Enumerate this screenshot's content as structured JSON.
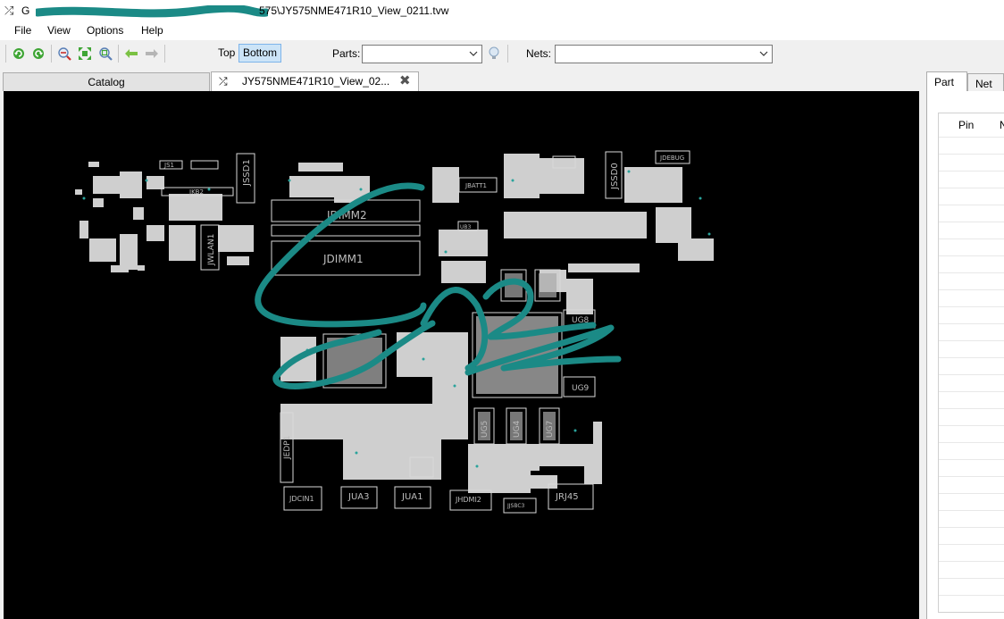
{
  "window": {
    "title_visible": "G",
    "title_path": "575\\JY575NME471R10_View_0211.tvw"
  },
  "menu": {
    "items": [
      "File",
      "View",
      "Options",
      "Help"
    ]
  },
  "toolbar": {
    "side_top": "Top",
    "side_bottom": "Bottom",
    "active_side": "Bottom",
    "parts_label": "Parts:",
    "parts_value": "",
    "nets_label": "Nets:",
    "nets_value": ""
  },
  "tabs": {
    "catalog": "Catalog",
    "view": "JY575NME471R10_View_02..."
  },
  "side_panel": {
    "tabs": [
      "Part",
      "Net"
    ],
    "active_tab": "Part",
    "columns": [
      "Pin",
      "N"
    ]
  },
  "board": {
    "labels": {
      "js1": "JS1",
      "jkb2": "JKB2",
      "jssd1": "JSSD1",
      "jwlan1": "JWLAN1",
      "jdimm2": "JDIMM2",
      "jdimm1": "JDIMM1",
      "jbatt1": "JBATT1",
      "ub3": "UB3",
      "jssd0": "JSSD0",
      "jdebug": "JDEBUG",
      "ug8": "UG8",
      "ug9": "UG9",
      "jedp1": "JEDP1",
      "ug5": "UG5",
      "ug4": "UG4",
      "ug7": "UG7",
      "jdcin1": "JDCIN1",
      "jua3": "JUA3",
      "jua1": "JUA1",
      "jhdmi2": "JHDMI2",
      "jjsbc3": "JJSBC3",
      "jrj45": "JRJ45"
    }
  },
  "colors": {
    "canvas_bg": "#000000",
    "trace": "#d8d8d8",
    "annotation_ink": "#1b8a86",
    "active_toggle": "#cce4f7"
  },
  "icons": {
    "app": "shuffle-icon",
    "toolbar": [
      "rotate-left-icon",
      "rotate-right-icon",
      "zoom-in-icon",
      "fit-view-icon",
      "zoom-area-icon",
      "back-arrow-icon",
      "forward-arrow-icon",
      "highlight-bulb-icon"
    ]
  }
}
